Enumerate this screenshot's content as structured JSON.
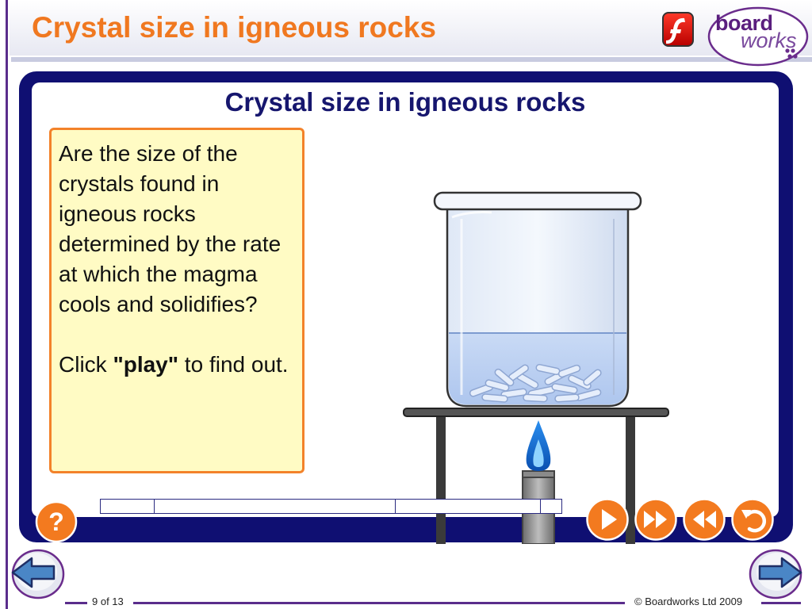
{
  "slide": {
    "title": "Crystal size in igneous rocks",
    "page_indicator": "9 of 13",
    "copyright": "© Boardworks Ltd 2009"
  },
  "logo": {
    "brand_line1": "board",
    "brand_line2": "works"
  },
  "activity": {
    "title": "Crystal size in igneous rocks",
    "question": "Are the size of the crystals found in igneous rocks determined by the rate at which the magma cools and solidifies?",
    "instruction_prefix": "Click ",
    "instruction_keyword": "\"play\"",
    "instruction_suffix": " to find out."
  },
  "controls": {
    "help": "?",
    "icons": [
      "play-icon",
      "fast-forward-icon",
      "rewind-icon",
      "replay-icon"
    ]
  },
  "colors": {
    "title_orange": "#f07820",
    "panel_navy": "#0f0f72",
    "button_orange": "#f37a1f",
    "box_fill": "#fffbc4",
    "box_border": "#f3822a"
  }
}
